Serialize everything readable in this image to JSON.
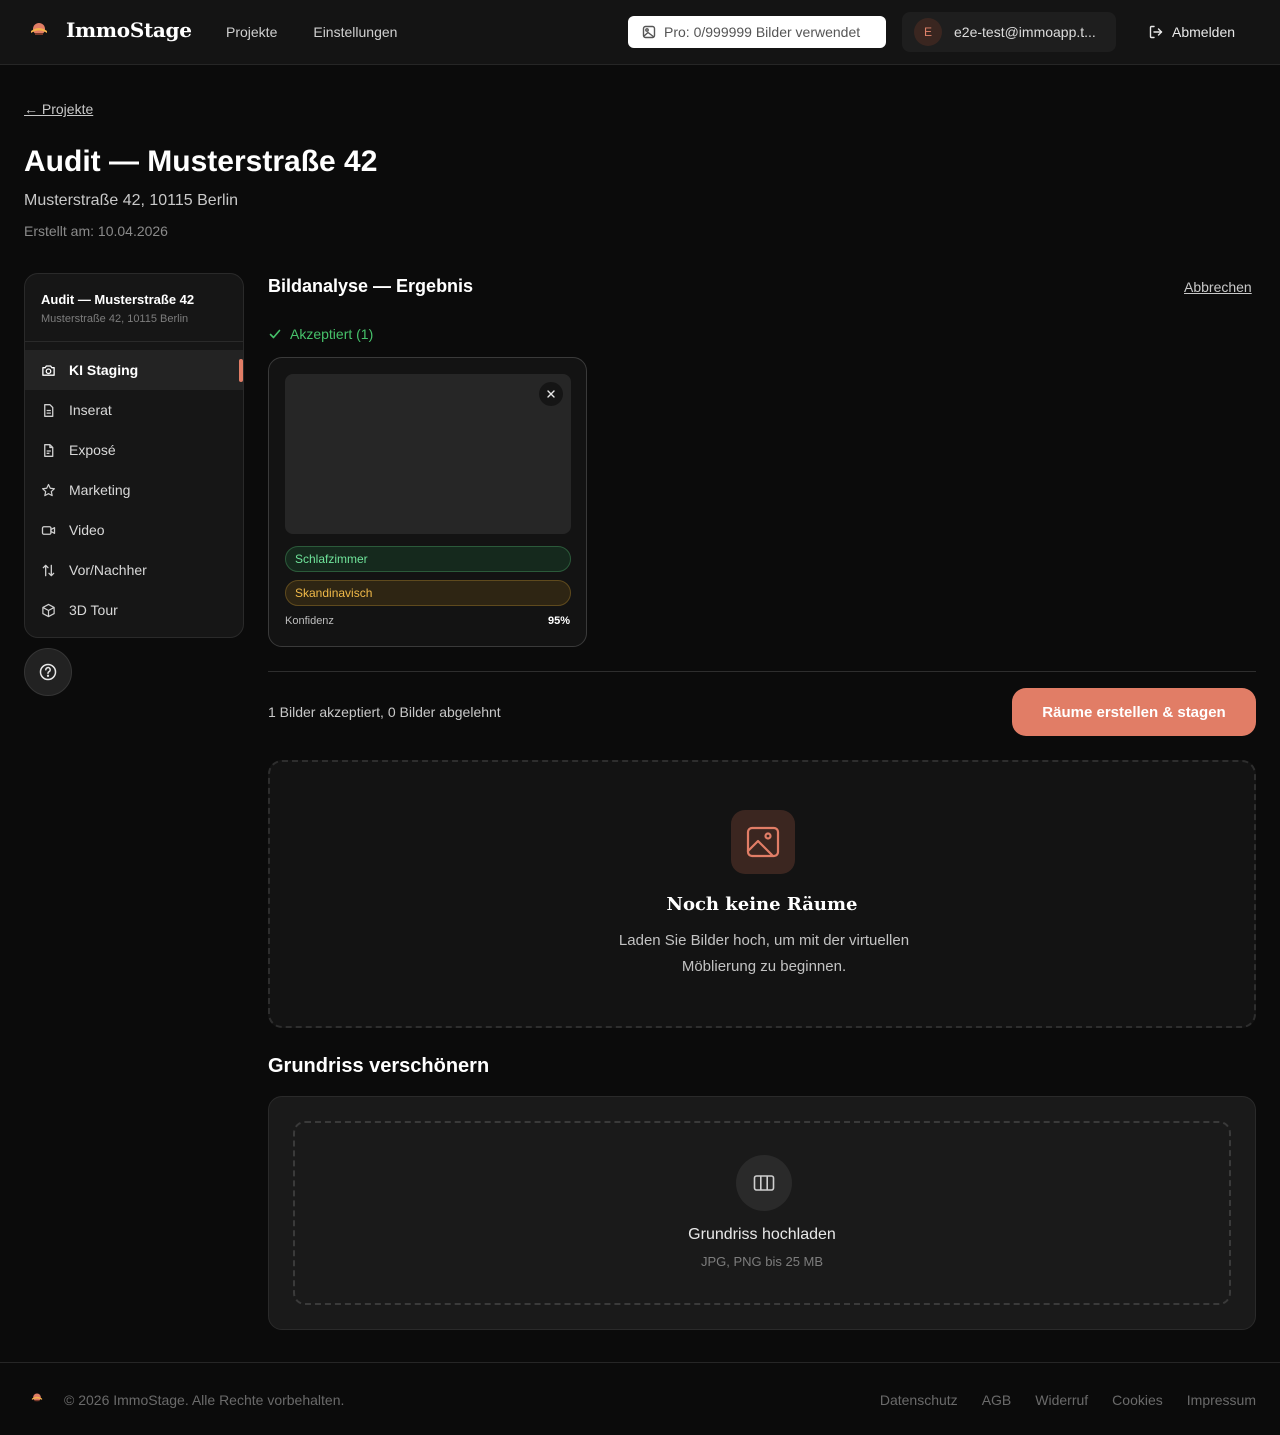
{
  "header": {
    "brand": "ImmoStage",
    "nav": [
      {
        "label": "Projekte"
      },
      {
        "label": "Einstellungen"
      }
    ],
    "usage": "Pro: 0/999999 Bilder verwendet",
    "user_initial": "E",
    "user_email": "e2e-test@immoapp.t...",
    "logout_label": "Abmelden"
  },
  "project": {
    "back_label": "← Projekte",
    "title": "Audit — Musterstraße 42",
    "address": "Musterstraße 42, 10115 Berlin",
    "created": "Erstellt am: 10.04.2026"
  },
  "sidebar": {
    "title": "Audit — Musterstraße 42",
    "subtitle": "Musterstraße 42, 10115 Berlin",
    "items": [
      {
        "label": "KI Staging",
        "icon": "camera-icon"
      },
      {
        "label": "Inserat",
        "icon": "document-icon"
      },
      {
        "label": "Exposé",
        "icon": "file-text-icon"
      },
      {
        "label": "Marketing",
        "icon": "star-icon"
      },
      {
        "label": "Video",
        "icon": "video-icon"
      },
      {
        "label": "Vor/Nachher",
        "icon": "swap-arrows-icon"
      },
      {
        "label": "3D Tour",
        "icon": "cube-icon"
      }
    ]
  },
  "analysis": {
    "title": "Bildanalyse — Ergebnis",
    "cancel_label": "Abbrechen",
    "accepted_label": "Akzeptiert (1)",
    "card": {
      "room_tag": "Schlafzimmer",
      "style_tag": "Skandinavisch",
      "confidence_label": "Konfidenz",
      "confidence_value": "95%"
    },
    "summary": "1 Bilder akzeptiert, 0 Bilder abgelehnt",
    "action_label": "Räume erstellen & stagen"
  },
  "empty_state": {
    "title": "Noch keine Räume",
    "description": "Laden Sie Bilder hoch, um mit der virtuellen Möblierung zu beginnen."
  },
  "floorplan": {
    "title": "Grundriss verschönern",
    "upload_title": "Grundriss hochladen",
    "upload_hint": "JPG, PNG bis 25 MB"
  },
  "footer": {
    "copyright": "© 2026 ImmoStage. Alle Rechte vorbehalten.",
    "links": [
      {
        "label": "Datenschutz"
      },
      {
        "label": "AGB"
      },
      {
        "label": "Widerruf"
      },
      {
        "label": "Cookies"
      },
      {
        "label": "Impressum"
      }
    ]
  },
  "colors": {
    "accent": "#e17d66",
    "success": "#46c16a",
    "warning": "#f0b948",
    "background": "#0b0b0b",
    "surface": "#161616"
  }
}
